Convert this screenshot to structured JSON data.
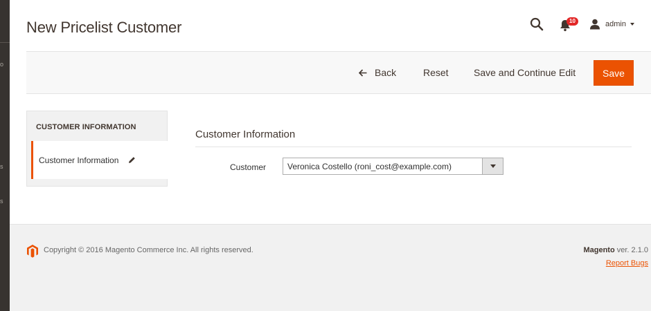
{
  "left_rail": {
    "items": [
      "o",
      "s",
      "s"
    ]
  },
  "header": {
    "title": "New Pricelist Customer",
    "notifications_count": "10",
    "user_name": "admin"
  },
  "actions": {
    "back_label": "Back",
    "reset_label": "Reset",
    "save_continue_label": "Save and Continue Edit",
    "save_label": "Save"
  },
  "side_panel": {
    "title": "CUSTOMER INFORMATION",
    "tab_label": "Customer Information"
  },
  "form": {
    "heading": "Customer Information",
    "customer_label": "Customer",
    "customer_value": "Veronica Costello (roni_cost@example.com)"
  },
  "footer": {
    "copyright": "Copyright © 2016 Magento Commerce Inc. All rights reserved.",
    "brand": "Magento",
    "version": " ver. 2.1.0",
    "report_bugs": "Report Bugs"
  },
  "colors": {
    "accent": "#eb5202",
    "badge": "#e22626",
    "rail": "#373330"
  }
}
